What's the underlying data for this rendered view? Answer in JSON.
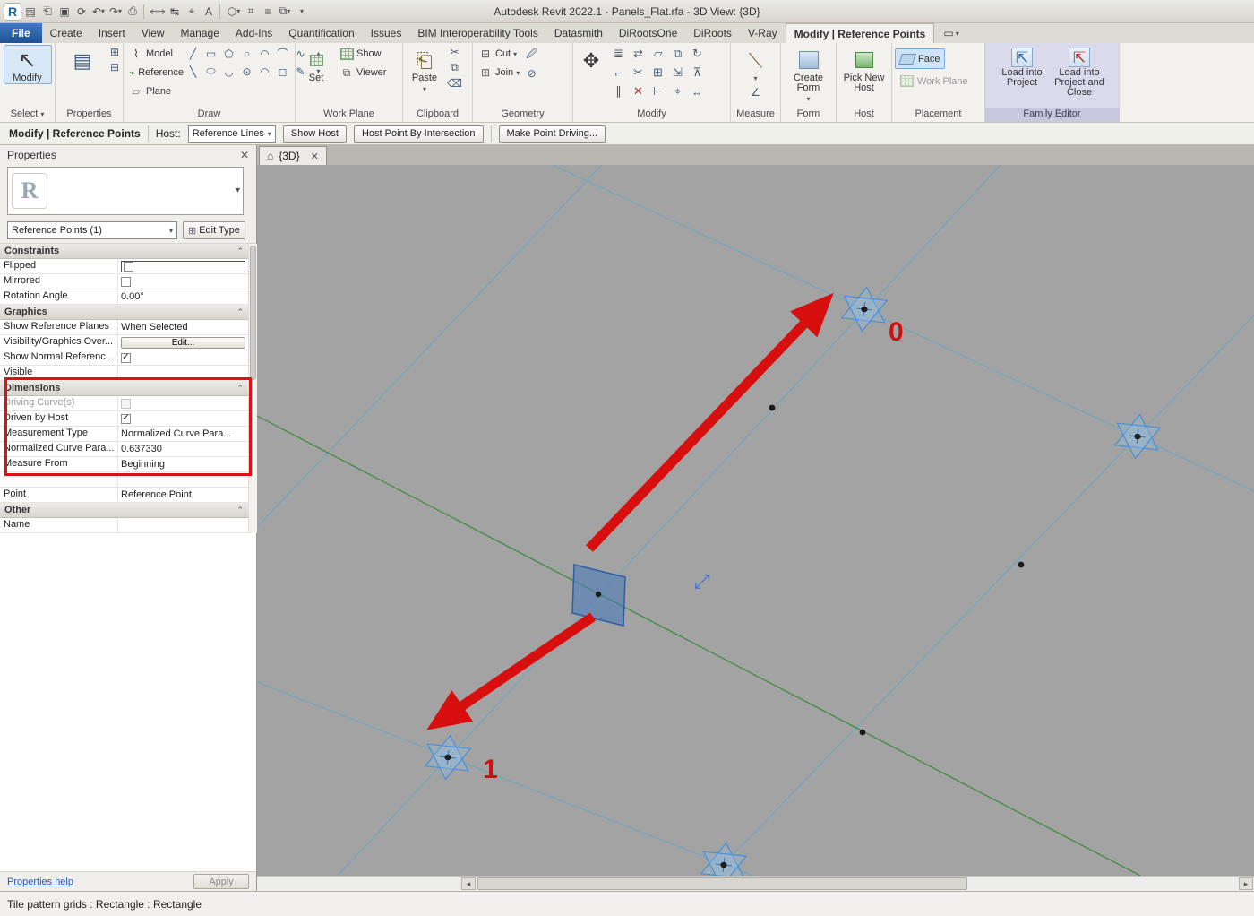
{
  "title_bar": {
    "app_title": "Autodesk Revit 2022.1 - Panels_Flat.rfa - 3D View: {3D}"
  },
  "tab_bar": {
    "tabs": [
      "File",
      "Create",
      "Insert",
      "View",
      "Manage",
      "Add-Ins",
      "Quantification",
      "Issues",
      "BIM Interoperability Tools",
      "Datasmith",
      "DiRootsOne",
      "DiRoots",
      "V-Ray",
      "Modify | Reference Points"
    ],
    "active": "Modify | Reference Points"
  },
  "ribbon": {
    "select_panel": {
      "modify": "Modify",
      "footer": "Select"
    },
    "properties_panel": {
      "footer": "Properties"
    },
    "draw_panel": {
      "model": "Model",
      "reference": "Reference",
      "plane": "Plane",
      "footer": "Draw"
    },
    "workplane_panel": {
      "set": "Set",
      "show": "Show",
      "viewer": "Viewer",
      "footer": "Work Plane"
    },
    "clipboard_panel": {
      "paste": "Paste",
      "footer": "Clipboard"
    },
    "geometry_panel": {
      "cut": "Cut",
      "join": "Join",
      "footer": "Geometry"
    },
    "modify_panel": {
      "footer": "Modify"
    },
    "measure_panel": {
      "footer": "Measure"
    },
    "form_panel": {
      "create_form": "Create Form",
      "footer": "Form"
    },
    "host_panel": {
      "pick_new_host": "Pick New Host",
      "footer": "Host"
    },
    "placement_panel": {
      "face": "Face",
      "work_plane": "Work Plane",
      "footer": "Placement"
    },
    "family_editor_panel": {
      "load": "Load into Project",
      "load_close": "Load into Project and Close",
      "footer": "Family Editor"
    }
  },
  "options_bar": {
    "mode": "Modify | Reference Points",
    "host_label": "Host:",
    "host_value": "Reference Lines",
    "show_host": "Show Host",
    "host_point_by_intersection": "Host Point By Intersection",
    "make_point_driving": "Make Point Driving..."
  },
  "properties": {
    "title": "Properties",
    "filter_value": "Reference Points (1)",
    "edit_type": "Edit Type",
    "help": "Properties help",
    "apply": "Apply",
    "rows": [
      {
        "label": "Constraints",
        "value": ""
      },
      {
        "label": "Flipped",
        "value": ""
      },
      {
        "label": "Mirrored",
        "value": ""
      },
      {
        "label": "Rotation Angle",
        "value": "0.00°"
      },
      {
        "label": "Graphics",
        "value": ""
      },
      {
        "label": "Show Reference Planes",
        "value": "When Selected"
      },
      {
        "label": "Visibility/Graphics Over...",
        "value": "Edit..."
      },
      {
        "label": "Show Normal Referenc...",
        "value": ""
      },
      {
        "label": "Visible",
        "value": ""
      },
      {
        "label": "Dimensions",
        "value": ""
      },
      {
        "label": "Driving Curve(s)",
        "value": ""
      },
      {
        "label": "Driven by Host",
        "value": ""
      },
      {
        "label": "Measurement Type",
        "value": "Normalized Curve Para..."
      },
      {
        "label": "Normalized Curve Para...",
        "value": "0.637330"
      },
      {
        "label": "Measure From",
        "value": "Beginning"
      },
      {
        "label": "",
        "value": ""
      },
      {
        "label": "Point",
        "value": "Reference Point"
      },
      {
        "label": "Other",
        "value": ""
      },
      {
        "label": "Name",
        "value": ""
      }
    ]
  },
  "view": {
    "tab": "{3D}",
    "labels": {
      "zero": "0",
      "one": "1"
    }
  },
  "status_bar": {
    "text": "Tile pattern grids : Rectangle : Rectangle"
  },
  "colors": {
    "highlight_red": "#dd1111",
    "grid_blue": "#6aa7c4",
    "grid_green": "#3c8a3c",
    "selection_blue": "#4a90d9"
  }
}
